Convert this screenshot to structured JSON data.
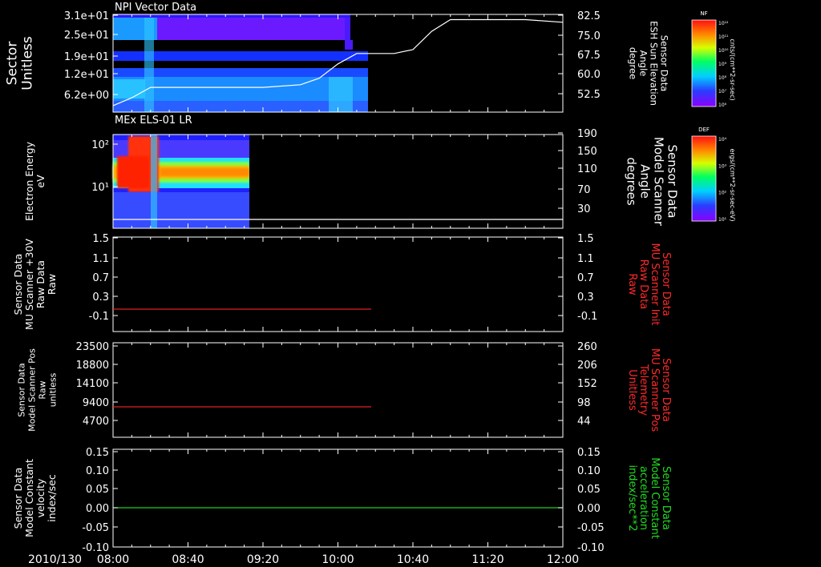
{
  "date_label": "2010/130",
  "time_ticks": [
    "08:00",
    "08:40",
    "09:20",
    "10:00",
    "10:40",
    "11:20",
    "12:00"
  ],
  "panels": [
    {
      "title": "NPI Vector Data",
      "left_label": [
        "Sector",
        "Unitless"
      ],
      "left_ticks": [
        "3.1e+01",
        "2.5e+01",
        "1.9e+01",
        "1.2e+01",
        "6.2e+00"
      ],
      "right_label": [
        "Sensor Data",
        "ESH Sun Elevation",
        "Angle",
        "degree"
      ],
      "right_ticks": [
        "82.5",
        "75.0",
        "67.5",
        "60.0",
        "52.5"
      ],
      "right_label_color": "#ffffff",
      "colorbar": {
        "tag": "NF",
        "units": "cnts/(cm**2-sr-sec)",
        "ticks": [
          "10¹²",
          "10¹¹",
          "10¹⁰",
          "10⁹",
          "10⁸",
          "10⁷",
          "10⁶"
        ]
      }
    },
    {
      "title": "MEx ELS-01 LR",
      "left_label": [
        "Electron Energy",
        "eV"
      ],
      "left_ticks": [
        "10²",
        "10¹"
      ],
      "right_label": [
        "Sensor Data",
        "Model Scanner",
        "Angle",
        "degrees"
      ],
      "right_ticks": [
        "190",
        "150",
        "110",
        "70",
        "30"
      ],
      "right_label_color": "#ffffff",
      "colorbar": {
        "tag": "DEF",
        "units": "ergs/(cm**2-sr-sec-eV)",
        "ticks": [
          "10⁴",
          "10³",
          "10²",
          "10¹"
        ]
      }
    },
    {
      "left_label": [
        "Sensor Data",
        "MU Scanner +30V",
        "Raw Data",
        "Raw"
      ],
      "left_ticks": [
        "1.5",
        "1.1",
        "0.7",
        "0.3",
        "-0.1"
      ],
      "right_label": [
        "Sensor Data",
        "MU Scanner Init",
        "Raw Data",
        "Raw"
      ],
      "right_ticks": [
        "1.5",
        "1.1",
        "0.7",
        "0.3",
        "-0.1"
      ],
      "right_label_color": "#ff2a2a"
    },
    {
      "left_label": [
        "Sensor Data",
        "Model Scanner Pos",
        "Raw",
        "unitless"
      ],
      "left_ticks": [
        "23500",
        "18800",
        "14100",
        "9400",
        "4700"
      ],
      "right_label": [
        "Sensor Data",
        "MU Scanner Pos",
        "Telemetry",
        "Unitless"
      ],
      "right_ticks": [
        "260",
        "206",
        "152",
        "98",
        "44"
      ],
      "right_label_color": "#ff2a2a"
    },
    {
      "left_label": [
        "Sensor Data",
        "Model Constant",
        "velocity",
        "index/sec"
      ],
      "left_ticks": [
        "0.15",
        "0.10",
        "0.05",
        "0.00",
        "-0.05",
        "-0.10"
      ],
      "right_label": [
        "Sensor Data",
        "Model Constant",
        "acceleration",
        "index/sec**2"
      ],
      "right_ticks": [
        "0.15",
        "0.10",
        "0.05",
        "0.00",
        "-0.05",
        "-0.10"
      ],
      "right_label_color": "#22dd22"
    }
  ],
  "chart_data": [
    {
      "type": "heatmap",
      "title": "NPI Vector Data",
      "ylabel": "Sector Unitless",
      "ylim": [
        0,
        31
      ],
      "x_range": [
        "08:00",
        "12:00"
      ],
      "data_coverage": [
        "08:00",
        "10:04"
      ],
      "overlay_line": {
        "name": "ESH Sun Elevation Angle",
        "ylim_right": [
          45,
          82.5
        ],
        "x": [
          "08:00",
          "08:10",
          "08:20",
          "08:40",
          "09:20",
          "09:40",
          "09:50",
          "10:00",
          "10:10",
          "10:20",
          "10:30",
          "10:40",
          "10:50",
          "11:00",
          "11:20",
          "11:40",
          "12:00"
        ],
        "y": [
          47.5,
          50.5,
          54.5,
          54.5,
          54.5,
          55.5,
          58.0,
          63.5,
          67.5,
          67.5,
          67.5,
          69.0,
          76.0,
          80.5,
          80.5,
          80.5,
          79.5
        ]
      }
    },
    {
      "type": "heatmap",
      "title": "MEx ELS-01 LR",
      "ylabel": "Electron Energy eV",
      "yscale": "log",
      "x_range": [
        "08:00",
        "12:00"
      ],
      "data_coverage": [
        "08:00",
        "09:15"
      ],
      "overlay_line": {
        "name": "Model Scanner Angle",
        "ylim_right": [
          10,
          190
        ],
        "x": [
          "08:00",
          "12:00"
        ],
        "y": [
          12,
          12
        ]
      }
    },
    {
      "type": "line",
      "ylim": [
        -0.3,
        1.5
      ],
      "series": [
        {
          "name": "MU Scanner +30V",
          "color": "#e02020",
          "x": [
            "08:00",
            "10:04"
          ],
          "y": [
            0.0,
            0.0
          ]
        }
      ]
    },
    {
      "type": "line",
      "ylim": [
        0,
        23500
      ],
      "series": [
        {
          "name": "Model Scanner Pos",
          "color": "#e02020",
          "x": [
            "08:00",
            "10:04"
          ],
          "y": [
            7700,
            7700
          ]
        }
      ]
    },
    {
      "type": "line",
      "ylim": [
        -0.1,
        0.15
      ],
      "series": [
        {
          "name": "Model Constant velocity",
          "color": "#22cc22",
          "x": [
            "08:00",
            "12:00"
          ],
          "y": [
            0.0,
            0.0
          ]
        }
      ]
    }
  ]
}
